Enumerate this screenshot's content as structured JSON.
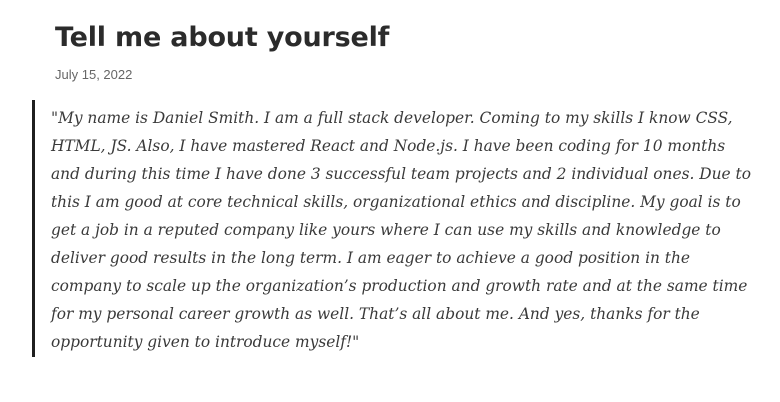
{
  "post": {
    "title": "Tell me about yourself",
    "date": "July 15, 2022",
    "quote": "\"My name is Daniel Smith. I am a full stack developer. Coming to my skills I know CSS, HTML, JS. Also, I have mastered React and Node.js. I have been coding for 10 months and during this time I have done 3 successful team projects and 2 individual ones. Due to this I am good at core technical skills, organizational ethics and discipline. My goal is to get a job in a reputed company like yours where I can use my skills and knowledge to deliver good results in the long term. I am eager to achieve a good position in the company to scale up the organization’s production and growth rate and at the same time for my personal career growth as well. That’s all about me. And yes, thanks for the opportunity given to introduce myself!\""
  }
}
